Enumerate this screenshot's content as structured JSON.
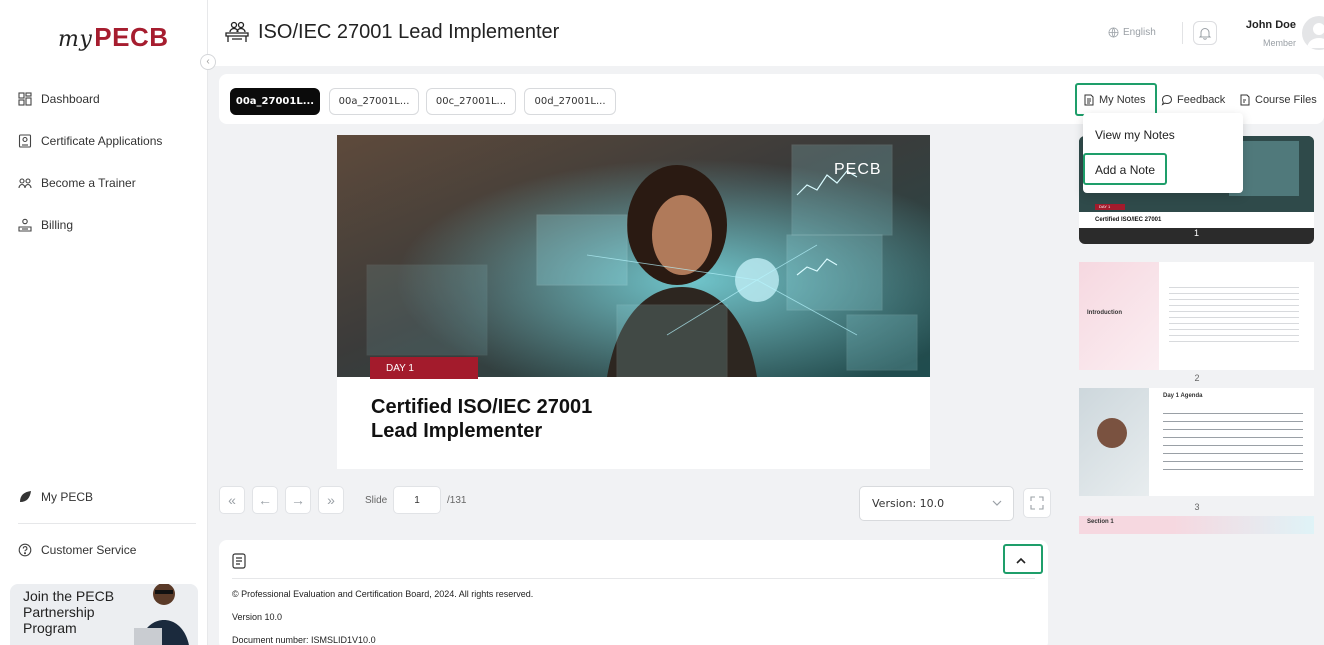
{
  "brand": {
    "my": "my",
    "name": "PECB",
    "color": "#a61d2f"
  },
  "sidebar": {
    "items": [
      {
        "label": "Dashboard",
        "icon": "dashboard-grid-icon"
      },
      {
        "label": "Certificate Applications",
        "icon": "certificate-icon"
      },
      {
        "label": "Become a Trainer",
        "icon": "trainer-icon"
      },
      {
        "label": "Billing",
        "icon": "billing-icon"
      }
    ],
    "bottom_items": [
      {
        "label": "My PECB",
        "icon": "leaf-icon"
      },
      {
        "label": "Customer Service",
        "icon": "help-circle-icon"
      }
    ],
    "promo": {
      "text": "Join the PECB Partnership Program"
    }
  },
  "header": {
    "title": "ISO/IEC 27001 Lead Implementer",
    "language": "English",
    "user": {
      "name": "John Doe",
      "role": "Member"
    }
  },
  "tabs": [
    {
      "label": "00a_27001L...",
      "active": true
    },
    {
      "label": "00a_27001L...",
      "active": false
    },
    {
      "label": "00c_27001L...",
      "active": false
    },
    {
      "label": "00d_27001L...",
      "active": false
    }
  ],
  "toolbar": {
    "my_notes": "My Notes",
    "feedback": "Feedback",
    "course_files": "Course Files"
  },
  "notes_menu": {
    "view": "View my Notes",
    "add": "Add a Note"
  },
  "slide": {
    "brand": "PECB",
    "day": "DAY 1",
    "title_line1": "Certified ISO/IEC 27001",
    "title_line2": "Lead Implementer"
  },
  "thumbnails": [
    {
      "number": "1",
      "title": "Certified ISO/IEC 27001",
      "badge": "DAY 1"
    },
    {
      "number": "2",
      "title": "Introduction"
    },
    {
      "number": "3",
      "title": "Day 1 Agenda"
    },
    {
      "title": "Section 1"
    }
  ],
  "controls": {
    "slide_label": "Slide",
    "current": "1",
    "total": "/131",
    "version": "Version: 10.0"
  },
  "notes": {
    "copyright": "© Professional Evaluation and Certification Board, 2024. All rights reserved.",
    "version": "Version 10.0",
    "document": "Document number: ISMSLID1V10.0"
  },
  "colors": {
    "highlight": "#1e9e6a",
    "accent_red": "#a31b2c",
    "active_tab": "#0b0b0b"
  }
}
